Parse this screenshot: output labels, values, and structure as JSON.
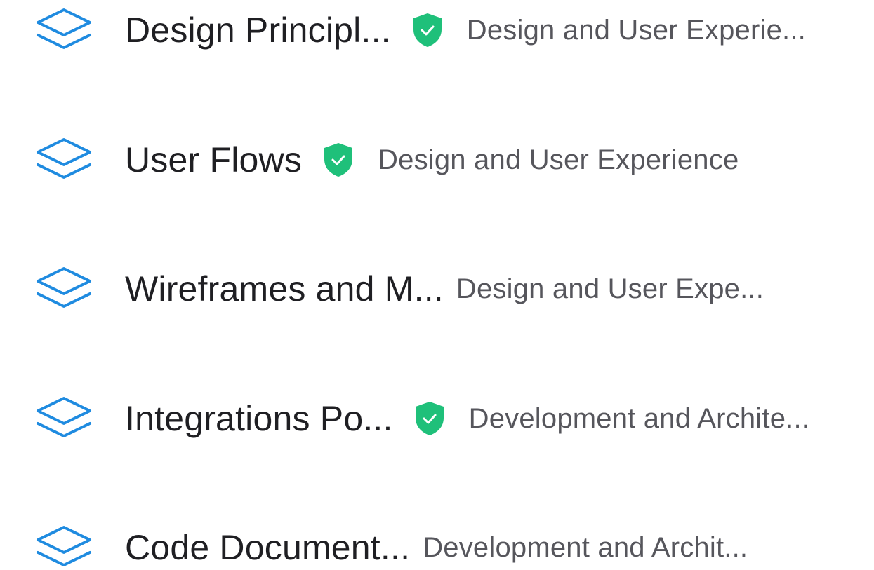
{
  "colors": {
    "icon_blue": "#1f8be0",
    "shield_green": "#1fc07a",
    "title_text": "#1f1f23",
    "category_text": "#56565c"
  },
  "items": [
    {
      "icon": "layers-icon",
      "title": "Design Principl...",
      "verified": true,
      "category": "Design and User Experie..."
    },
    {
      "icon": "layers-icon",
      "title": "User Flows",
      "verified": true,
      "category": "Design and User Experience"
    },
    {
      "icon": "layers-icon",
      "title": "Wireframes and M...",
      "verified": false,
      "category": "Design and User Expe..."
    },
    {
      "icon": "layers-icon",
      "title": "Integrations Po...",
      "verified": true,
      "category": "Development and Archite..."
    },
    {
      "icon": "layers-icon",
      "title": "Code Document...",
      "verified": false,
      "category": "Development and Archit..."
    }
  ]
}
